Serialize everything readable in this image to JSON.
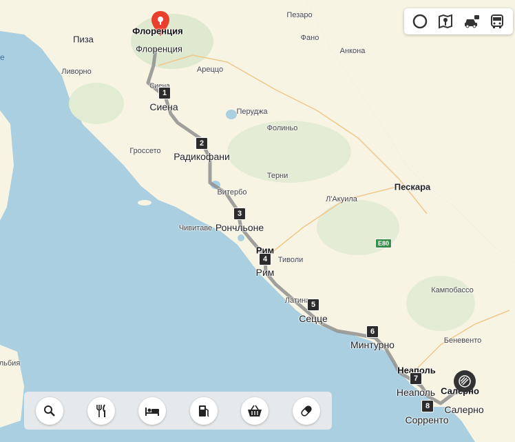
{
  "colors": {
    "sea": "#a9cfe0",
    "land": "#f8f4e3",
    "route": "#9e9e9e",
    "pin": "#e8402c",
    "marker": "#2b2b2b",
    "road_shield": "#3b8d4a"
  },
  "pin": {
    "title": "Флоренция",
    "icon": "map-pin-icon"
  },
  "cities": [
    {
      "id": "firenze-sub",
      "text": "Флоренция"
    },
    {
      "id": "pisa",
      "text": "Пиза"
    },
    {
      "id": "livorno",
      "text": "Ливорно"
    },
    {
      "id": "arezzo",
      "text": "Ареццо"
    },
    {
      "id": "siena-small",
      "text": "Сиена"
    },
    {
      "id": "perugia",
      "text": "Перуджа"
    },
    {
      "id": "foligno",
      "text": "Фолиньо"
    },
    {
      "id": "grosseto",
      "text": "Гроссето"
    },
    {
      "id": "terni",
      "text": "Терни"
    },
    {
      "id": "viterbo",
      "text": "Витербо"
    },
    {
      "id": "civitavecchia",
      "text": "Чивитаве"
    },
    {
      "id": "aquila",
      "text": "Л'Акуила"
    },
    {
      "id": "pescara",
      "text": "Пескара"
    },
    {
      "id": "pesaro",
      "text": "Пезаро"
    },
    {
      "id": "fano",
      "text": "Фано"
    },
    {
      "id": "ancona",
      "text": "Анкона"
    },
    {
      "id": "roma-bold",
      "text": "Рим"
    },
    {
      "id": "tivoli",
      "text": "Тиволи"
    },
    {
      "id": "latina",
      "text": "Латина"
    },
    {
      "id": "campobasso",
      "text": "Кампобассо"
    },
    {
      "id": "benevento",
      "text": "Беневенто"
    },
    {
      "id": "napoli-bold",
      "text": "Неаполь"
    },
    {
      "id": "salerno-bold",
      "text": "Салерно"
    },
    {
      "id": "olbia",
      "text": "льбия"
    }
  ],
  "stops": [
    {
      "n": "1",
      "label": "Сиена"
    },
    {
      "n": "2",
      "label": "Радикофани"
    },
    {
      "n": "3",
      "label": "Рончльоне"
    },
    {
      "n": "4",
      "label": "Рим"
    },
    {
      "n": "5",
      "label": "Сецце"
    },
    {
      "n": "6",
      "label": "Минтурно"
    },
    {
      "n": "7",
      "label": "Неаполь"
    },
    {
      "n": "8",
      "label": "Сорренто"
    }
  ],
  "end_label": "Салерно",
  "road_shield": "E80",
  "edge_text": "e",
  "top_buttons": [
    {
      "name": "alice-button",
      "icon": "assistant-icon"
    },
    {
      "name": "traffic-button",
      "icon": "traffic-light-icon"
    },
    {
      "name": "car-button",
      "icon": "car-icon"
    },
    {
      "name": "transit-button",
      "icon": "bus-icon"
    }
  ],
  "categories": [
    {
      "name": "search-category-button",
      "icon": "search-icon"
    },
    {
      "name": "food-category-button",
      "icon": "fork-knife-icon"
    },
    {
      "name": "hotels-category-button",
      "icon": "bed-icon"
    },
    {
      "name": "fuel-category-button",
      "icon": "fuel-icon"
    },
    {
      "name": "shops-category-button",
      "icon": "basket-icon"
    },
    {
      "name": "pharmacy-category-button",
      "icon": "pill-icon"
    }
  ]
}
